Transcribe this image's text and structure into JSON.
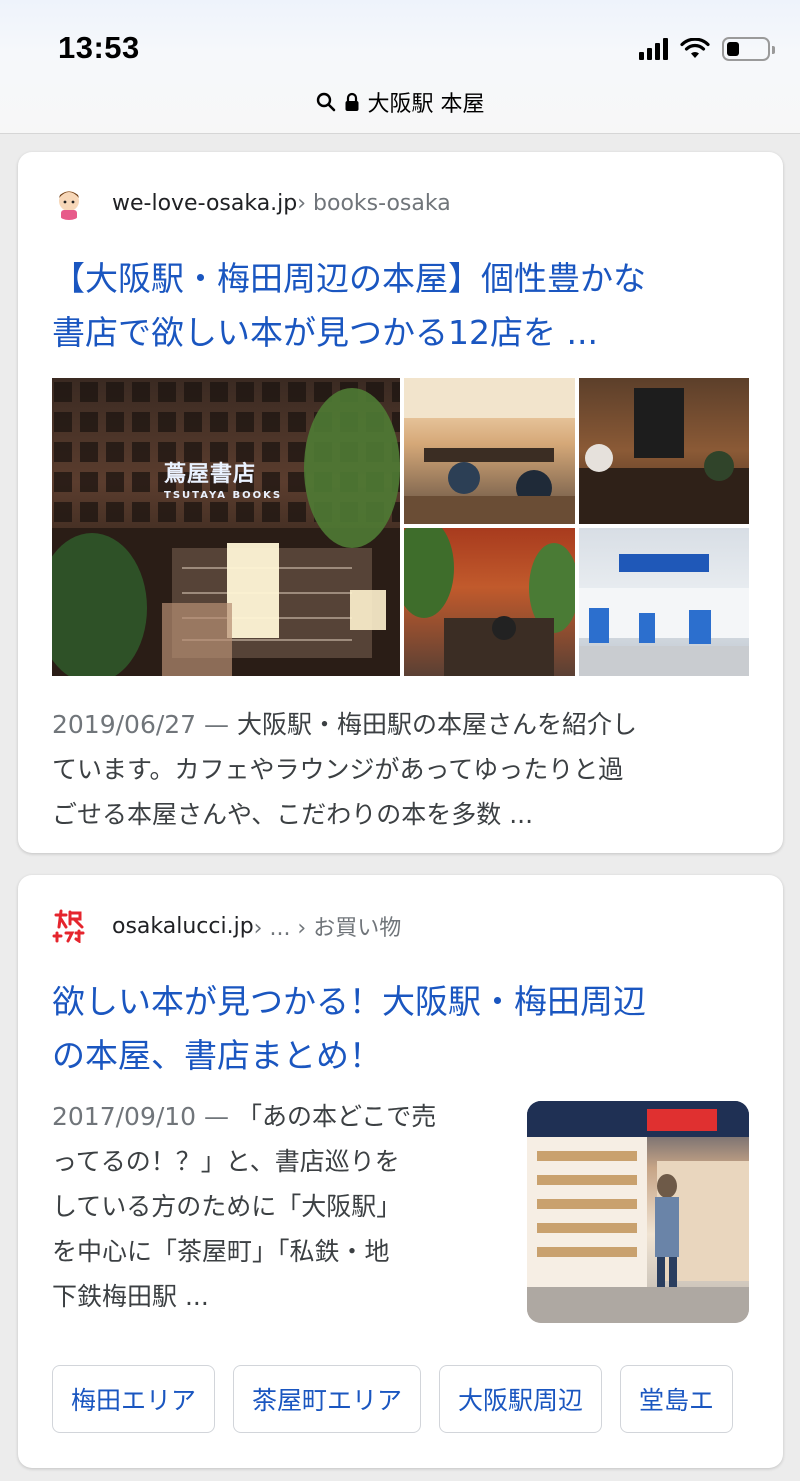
{
  "status_bar": {
    "time": "13:53"
  },
  "address_bar": {
    "query": "大阪駅 本屋"
  },
  "results": [
    {
      "domain": "we-love-osaka.jp",
      "breadcrumb": " › books-osaka",
      "title_line1": "【大阪駅・梅田周辺の本屋】個性豊かな",
      "title_line2": "書店で欲しい本が見つかる12店を ...",
      "image_sign": "蔦屋書店",
      "image_sign_sub": "TSUTAYA BOOKS",
      "date": "2019/06/27",
      "dash": " — ",
      "snippet_line1": "大阪駅・梅田駅の本屋さんを紹介し",
      "snippet_line2": "ています。カフェやラウンジがあってゆったりと過",
      "snippet_line3": "ごせる本屋さんや、こだわりの本を多数 ..."
    },
    {
      "domain": "osakalucci.jp",
      "breadcrumb": " › ... › お買い物",
      "title_line1": "欲しい本が見つかる！大阪駅・梅田周辺",
      "title_line2": "の本屋、書店まとめ！",
      "date": "2017/09/10",
      "dash": " — ",
      "snippet_line1": "「あの本どこで売",
      "snippet_line2": "ってるの！？」と、書店巡りを",
      "snippet_line3": "している方のために「大阪駅」",
      "snippet_line4": "を中心に「茶屋町」「私鉄・地",
      "snippet_line5": "下鉄梅田駅 ...",
      "chips": [
        "梅田エリア",
        "茶屋町エリア",
        "大阪駅周辺",
        "堂島エ"
      ]
    }
  ],
  "colors": {
    "link": "#1a56c0",
    "meta": "#70757a",
    "text": "#3c4043"
  },
  "icons": [
    "search-icon",
    "lock-icon",
    "signal-icon",
    "wifi-icon",
    "battery-icon"
  ]
}
